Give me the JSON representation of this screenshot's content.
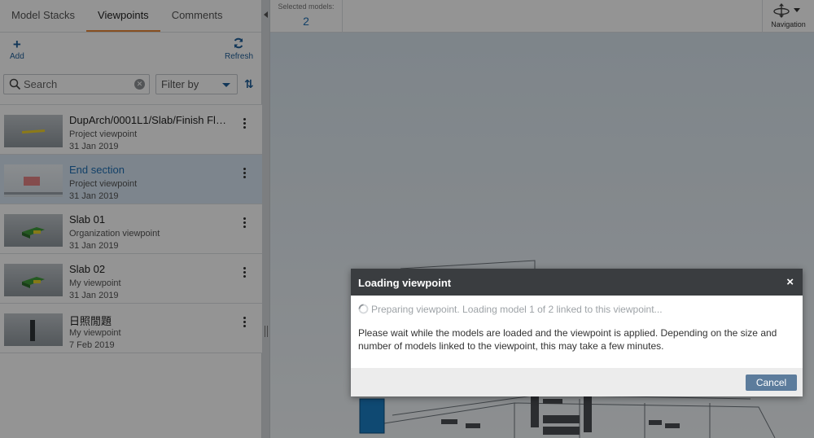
{
  "tabs": [
    {
      "label": "Model Stacks"
    },
    {
      "label": "Viewpoints"
    },
    {
      "label": "Comments"
    }
  ],
  "toolbar": {
    "add_label": "Add",
    "refresh_label": "Refresh"
  },
  "search": {
    "placeholder": "Search"
  },
  "filter": {
    "label": "Filter by"
  },
  "viewpoints": [
    {
      "title": "DupArch/0001L1/Slab/Finish Floor -...",
      "type": "Project viewpoint",
      "date": "31 Jan 2019"
    },
    {
      "title": "End section",
      "type": "Project viewpoint",
      "date": "31 Jan 2019"
    },
    {
      "title": "Slab 01",
      "type": "Organization viewpoint",
      "date": "31 Jan 2019"
    },
    {
      "title": "Slab 02",
      "type": "My viewpoint",
      "date": "31 Jan 2019"
    },
    {
      "title": "日照閒題",
      "type": "My viewpoint",
      "date": "7 Feb 2019"
    }
  ],
  "topbar": {
    "selected_label": "Selected models:",
    "selected_value": "2",
    "navigation_label": "Navigation"
  },
  "dialog": {
    "title": "Loading viewpoint",
    "close": "×",
    "status": "Preparing viewpoint. Loading model 1 of 2 linked to this viewpoint...",
    "message": "Please wait while the models are loaded and the viewpoint is applied. Depending on the size and number of models linked to the viewpoint, this may take a few minutes.",
    "cancel_label": "Cancel"
  },
  "colors": {
    "accent": "#e8893a",
    "link": "#1f6fb4",
    "button": "#5c7c9c"
  }
}
